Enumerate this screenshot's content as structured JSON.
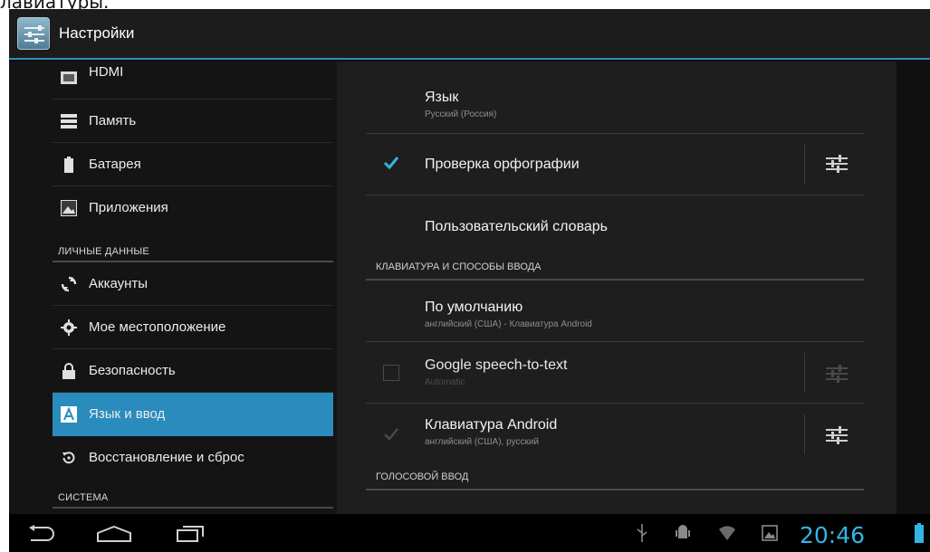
{
  "caption": "лавиатуры.",
  "app": {
    "title": "Настройки",
    "icon": "settings-icon"
  },
  "left_pane": {
    "items_top": [
      {
        "label": "HDMI",
        "icon": "hdmi-icon"
      },
      {
        "label": "Память",
        "icon": "storage-icon"
      },
      {
        "label": "Батарея",
        "icon": "battery-icon"
      },
      {
        "label": "Приложения",
        "icon": "apps-icon"
      }
    ],
    "header_personal": "ЛИЧНЫЕ ДАННЫЕ",
    "items_personal": [
      {
        "label": "Аккаунты",
        "icon": "sync-icon"
      },
      {
        "label": "Мое местоположение",
        "icon": "location-icon"
      },
      {
        "label": "Безопасность",
        "icon": "lock-icon"
      },
      {
        "label": "Язык и ввод",
        "icon": "language-icon",
        "selected": true
      },
      {
        "label": "Восстановление и сброс",
        "icon": "restore-icon"
      }
    ],
    "header_system": "СИСТЕМА"
  },
  "right_pane": {
    "language": {
      "title": "Язык",
      "value": "Русский (Россия)"
    },
    "spellcheck": {
      "title": "Проверка орфографии",
      "checked": true
    },
    "user_dictionary": {
      "title": "Пользовательский словарь"
    },
    "section_keyboard": "КЛАВИАТУРА И СПОСОБЫ ВВОДА",
    "default_input": {
      "title": "По умолчанию",
      "value": "английский (США) - Клавиатура Android"
    },
    "google_speech": {
      "title": "Google speech-to-text",
      "value": "Automatic",
      "checked": false,
      "enabled": false
    },
    "android_keyboard": {
      "title": "Клавиатура Android",
      "value": "английский (США), русский",
      "checked": true,
      "enabled": false
    },
    "section_voice": "ГОЛОСОВОЙ ВВОД"
  },
  "nav_bar": {
    "buttons": [
      "back-icon",
      "home-icon",
      "recent-apps-icon"
    ],
    "status_icons": [
      "usb-icon",
      "android-debug-icon",
      "wifi-icon",
      "screenshot-icon",
      "battery-icon"
    ],
    "time": "20:46"
  },
  "colors": {
    "accent": "#33b5e5",
    "selected_item": "#2a8bbd",
    "background": "#141414"
  }
}
